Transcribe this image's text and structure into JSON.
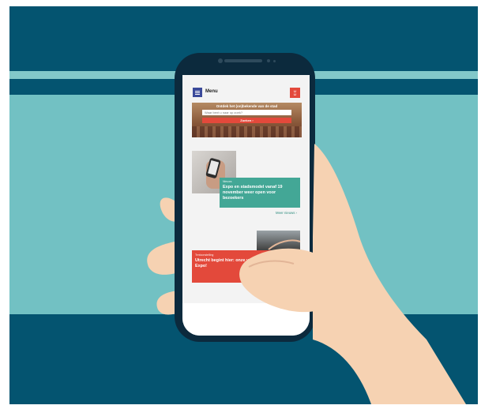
{
  "colors": {
    "dark_teal": "#045470",
    "light_teal": "#72c1c3",
    "phone_frame": "#0c2a3d",
    "accent_red": "#e3493b",
    "accent_green": "#43a796",
    "menu_blue": "#3b4a9a",
    "skin": "#f6d2b2"
  },
  "header": {
    "menu_icon": "hamburger-icon",
    "menu_label": "Menu",
    "logo_text_line1": "U",
    "logo_text_line2": "U"
  },
  "hero": {
    "title": "Ontdek het (on)bekende van de stad",
    "search_placeholder": "Waar bent u naar op zoek?",
    "search_button": "Zoeken"
  },
  "news": {
    "tag": "Nieuws",
    "title": "Expo en stadsmodel vanaf 19 november weer open voor bezoekers",
    "more_link": "Meer nieuws"
  },
  "event": {
    "tag": "Tentoonstelling",
    "title": "Utrecht begint hier: onze vernieuwde Expo!"
  }
}
